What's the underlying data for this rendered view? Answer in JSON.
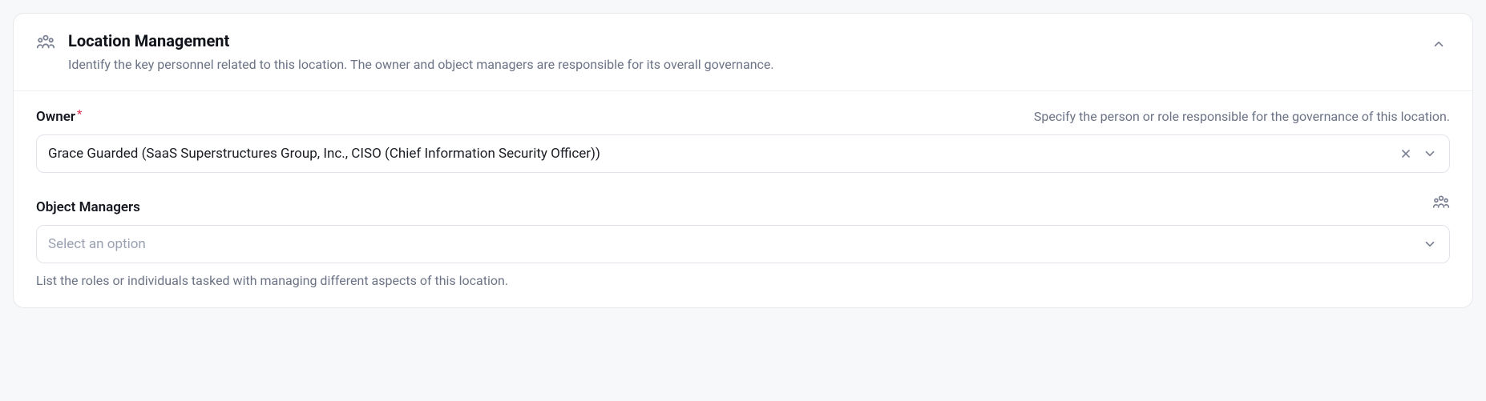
{
  "panel": {
    "title": "Location Management",
    "subtitle": "Identify the key personnel related to this location. The owner and object managers are responsible for its overall governance."
  },
  "fields": {
    "owner": {
      "label": "Owner",
      "required_mark": "*",
      "hint": "Specify the person or role responsible for the governance of this location.",
      "value": "Grace Guarded (SaaS Superstructures Group, Inc., CISO (Chief Information Security Officer))"
    },
    "objectManagers": {
      "label": "Object Managers",
      "placeholder": "Select an option",
      "hint_below": "List the roles or individuals tasked with managing different aspects of this location."
    }
  }
}
